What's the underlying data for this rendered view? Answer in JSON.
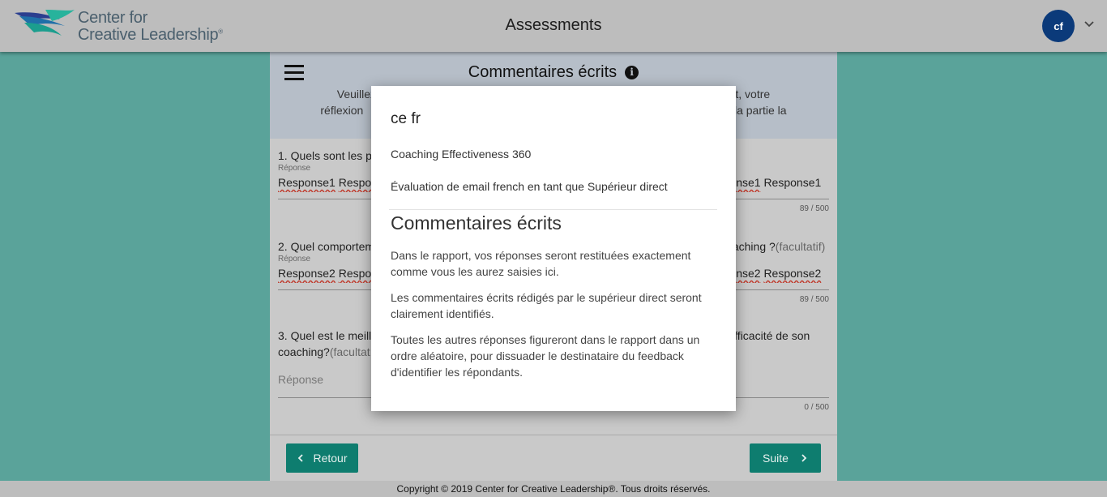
{
  "header": {
    "logo_line1": "Center for",
    "logo_line2": "Creative Leadership",
    "logo_trademark": "®",
    "title": "Assessments",
    "avatar_initials": "cf",
    "menu_icon": "chevron-down-icon"
  },
  "panel": {
    "title": "Commentaires écrits",
    "info_icon": "i",
    "intro_line1": "Veuillez r",
    "intro_line1_end": "n effet, votre",
    "intro_line2": "réflexion",
    "intro_line2_end": "e la partie la"
  },
  "questions": [
    {
      "text_start": "1. Quels sont les p",
      "label": "Réponse",
      "response_start": "Response1",
      "response_start2": "Respo",
      "response_end": "nse1",
      "response_end2": "Response1",
      "count": "89 / 500"
    },
    {
      "text_start": "2. Quel comportem",
      "text_end": "oaching ?",
      "optional": "(facultatif)",
      "label": "Réponse",
      "response_start": "Response2",
      "response_start2": "Respo",
      "response_end": "nse2",
      "response_end2": "Response2",
      "count": "89 / 500"
    },
    {
      "text_start": "3. Quel est le meill",
      "text_end": "fficacité de son",
      "text_line2": "coaching?",
      "optional": "(facultat",
      "placeholder": "Réponse",
      "count": "0 / 500"
    }
  ],
  "buttons": {
    "back": "Retour",
    "next": "Suite"
  },
  "footer": "Copyright © 2019 Center for Creative Leadership®. Tous droits réservés.",
  "modal": {
    "user": "ce fr",
    "survey": "Coaching Effectiveness 360",
    "evaluation": "Évaluation de email french en tant que Supérieur direct",
    "title": "Commentaires écrits",
    "para1": "Dans le rapport, vos réponses seront restituées exactement comme vous les aurez saisies ici.",
    "para2": "Les commentaires écrits rédigés par le supérieur direct seront clairement identifiés.",
    "para3": "Toutes les autres réponses figureront dans le rapport dans un ordre aléatoire, pour dissuader le destinataire du feedback d'identifier les répondants."
  },
  "colors": {
    "background": "#5aa39a",
    "header": "#bdbdbd",
    "accent_button": "#0e7d6f",
    "avatar": "#0b3a7a"
  }
}
